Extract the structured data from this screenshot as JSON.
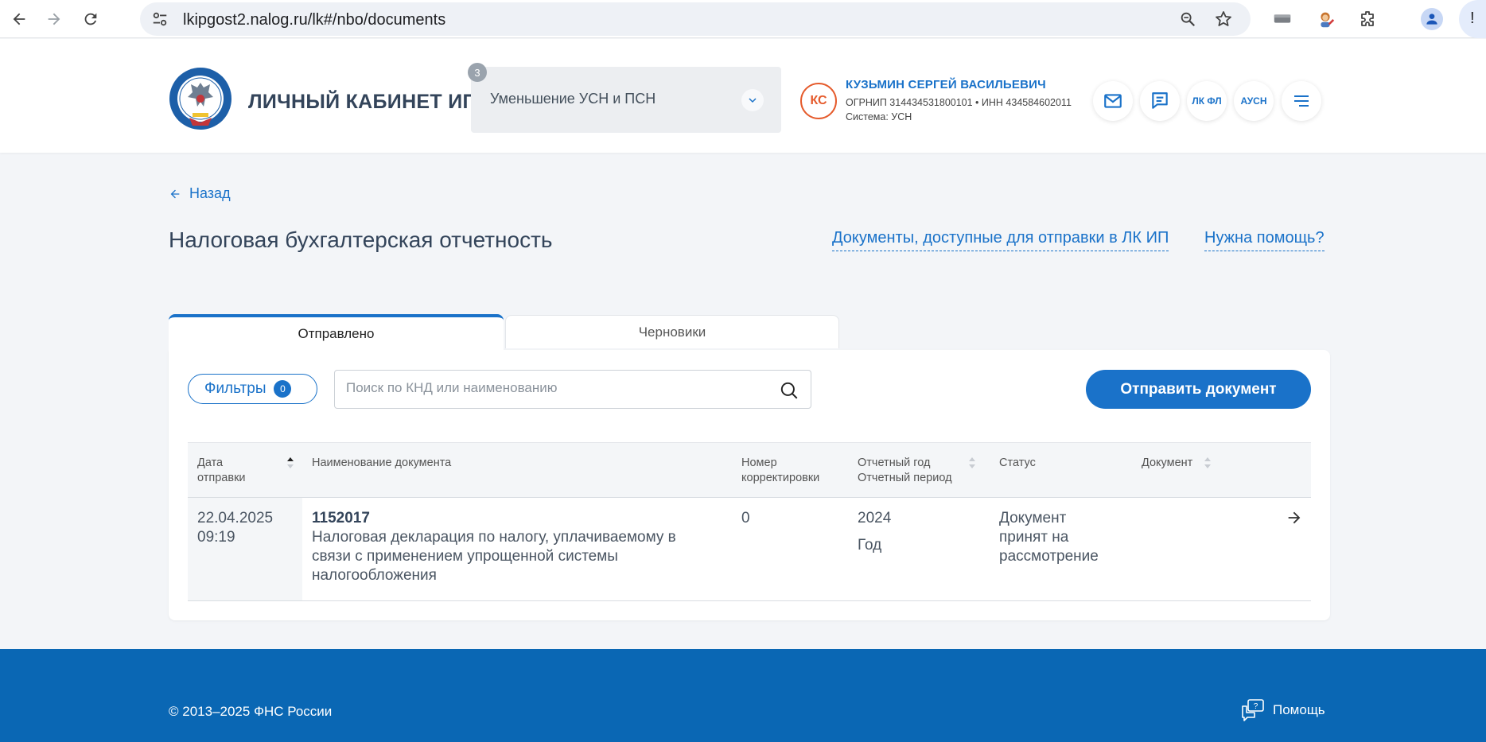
{
  "browser": {
    "url": "lkipgost2.nalog.ru/lk#/nbo/documents",
    "menu_glyph": "!"
  },
  "header": {
    "cabinet_title": "ЛИЧНЫЙ КАБИНЕТ ИП",
    "mode_badge": "3",
    "mode_label": "Уменьшение УСН и ПСН",
    "user": {
      "initials": "КС",
      "name": "КУЗЬМИН СЕРГЕЙ ВАСИЛЬЕВИЧ",
      "ids": "ОГРНИП 314434531800101 • ИНН 434584602011",
      "system": "Система: УСН"
    },
    "icons": {
      "lk_fl": "ЛК ФЛ",
      "ausn": "АУСН"
    }
  },
  "main": {
    "back_label": "Назад",
    "title": "Налоговая бухгалтерская отчетность",
    "links": {
      "documents": "Документы, доступные для отправки в ЛК ИП",
      "help": "Нужна помощь?"
    },
    "tabs": [
      {
        "label": "Отправлено",
        "active": true
      },
      {
        "label": "Черновики",
        "active": false
      }
    ],
    "filters_label": "Фильтры",
    "filters_count": "0",
    "search_placeholder": "Поиск по КНД или наименованию",
    "send_button": "Отправить документ",
    "table": {
      "headers": {
        "date_l1": "Дата",
        "date_l2": "отправки",
        "name": "Наименование документа",
        "corr_l1": "Номер",
        "corr_l2": "корректировки",
        "year_l1": "Отчетный год",
        "year_l2": "Отчетный период",
        "status": "Статус",
        "document": "Документ"
      },
      "rows": [
        {
          "date": "22.04.2025",
          "time": "09:19",
          "code": "1152017",
          "name_l1": "Налоговая декларация по налогу, уплачиваемому в",
          "name_l2": "связи с применением упрощенной системы",
          "name_l3": "налогообложения",
          "correction": "0",
          "year": "2024",
          "period": "Год",
          "status_l1": "Документ",
          "status_l2": "принят на",
          "status_l3": "рассмотрение"
        }
      ]
    }
  },
  "footer": {
    "copyright": "© 2013–2025 ФНС России",
    "help": "Помощь"
  },
  "colors": {
    "accent": "#1a72c9",
    "footer": "#0a67b4",
    "avatar": "#e55b2c"
  }
}
